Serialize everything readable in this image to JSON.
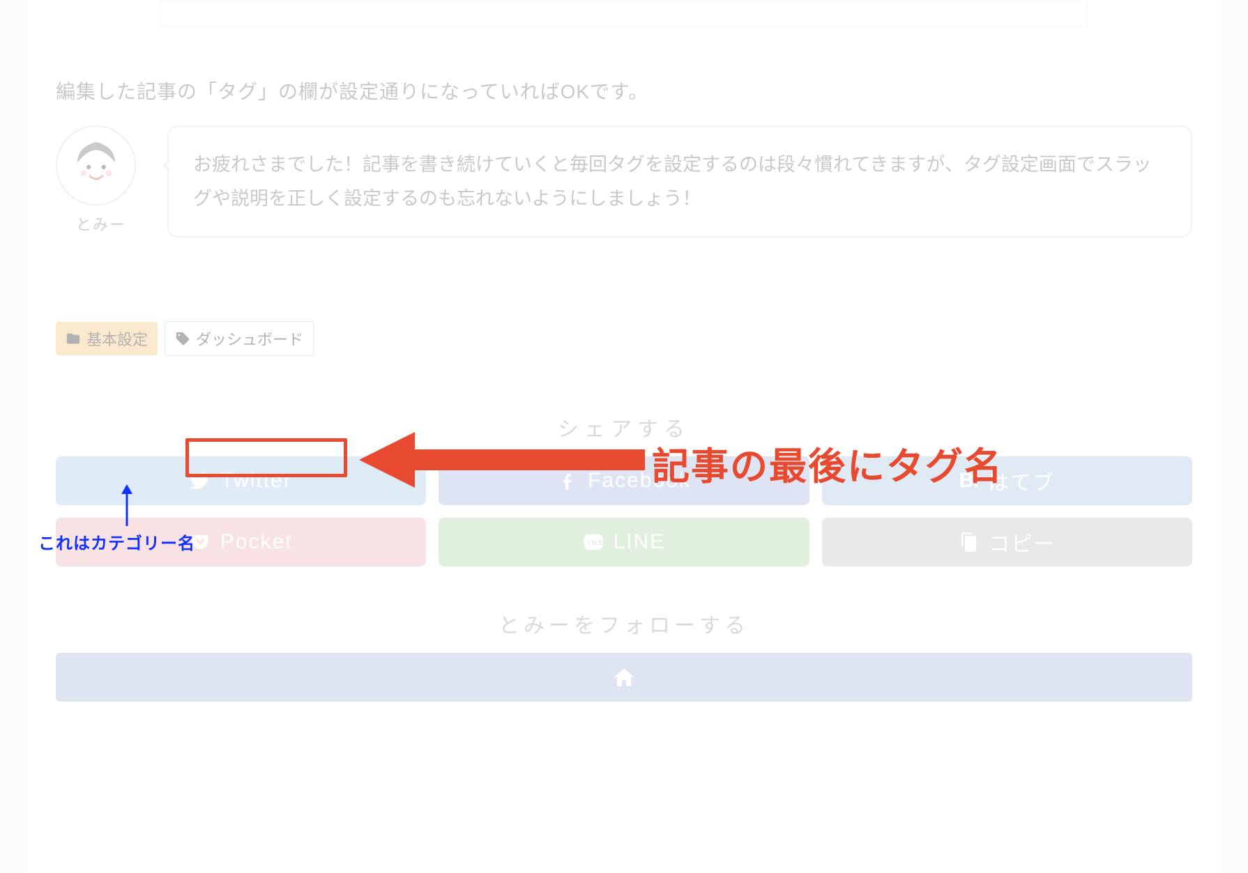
{
  "lead_text": "編集した記事の「タグ」の欄が設定通りになっていればOKです。",
  "avatar": {
    "name": "とみー"
  },
  "bubble_text": "お疲れさまでした！記事を書き続けていくと毎回タグを設定するのは段々慣れてきますが、タグ設定画面でスラッグや説明を正しく設定するのも忘れないようにしましょう！",
  "category_badge": {
    "label": "基本設定"
  },
  "tag_badge": {
    "label": "ダッシュボード"
  },
  "annotation": {
    "main_label": "記事の最後にタグ名",
    "sub_label": "これはカテゴリー名"
  },
  "share": {
    "heading": "シェアする",
    "twitter": "Twitter",
    "facebook": "Facebook",
    "hatena": "はてブ",
    "pocket": "Pocket",
    "line": "LINE",
    "copy": "コピー"
  },
  "follow": {
    "heading": "とみーをフォローする"
  }
}
